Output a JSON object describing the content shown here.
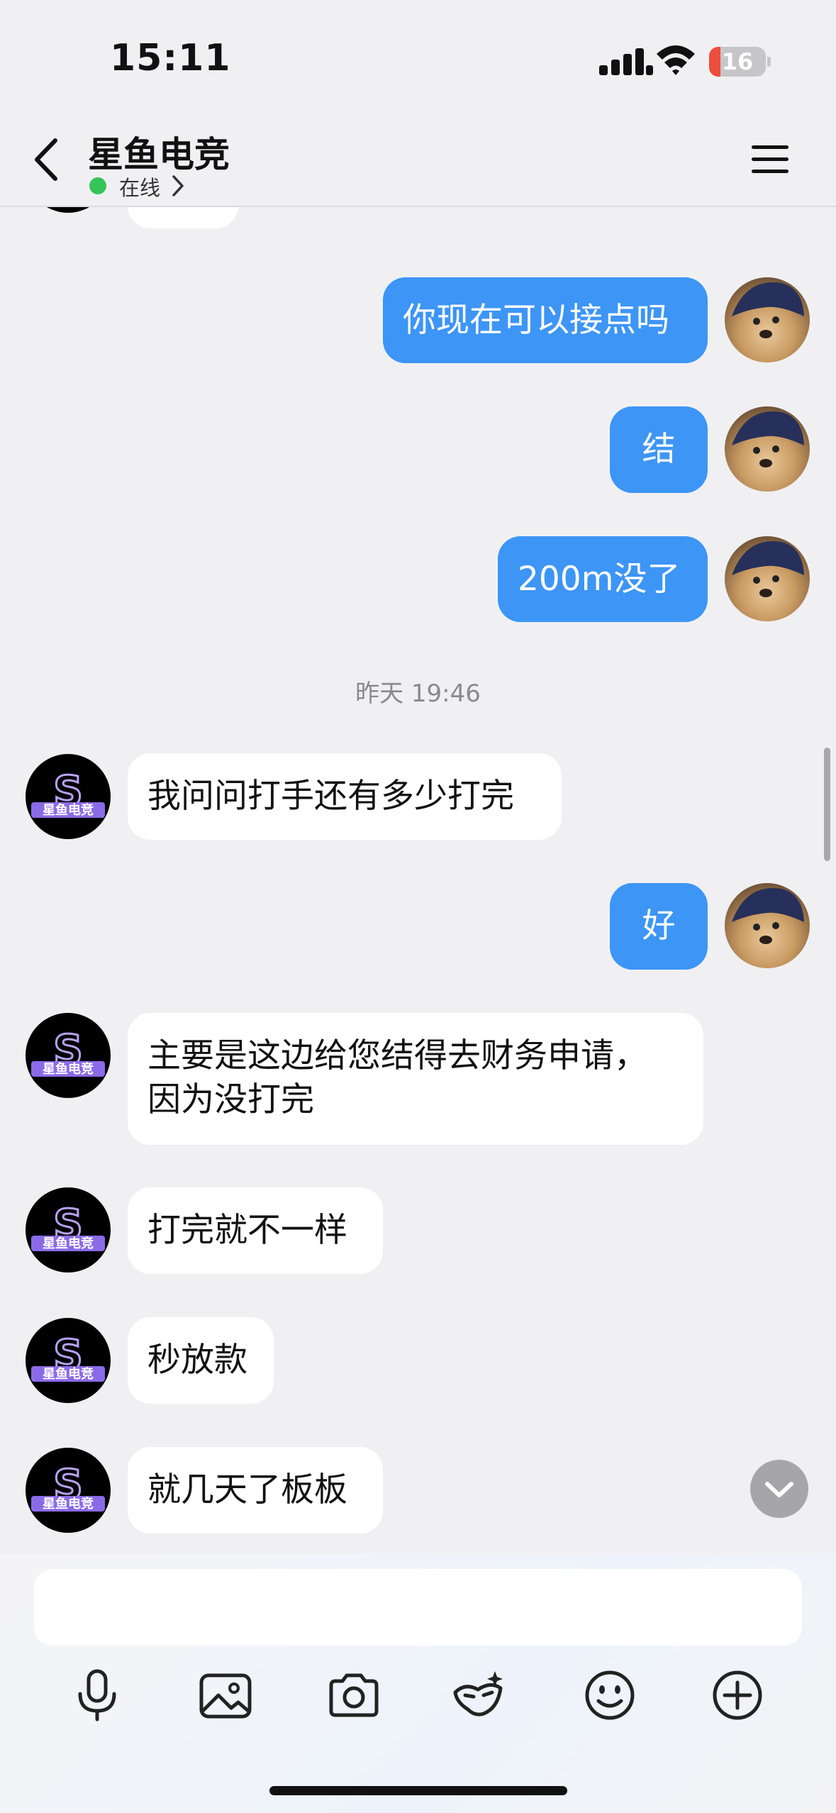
{
  "status_bar": {
    "time": "15:11",
    "battery": "16"
  },
  "header": {
    "title": "星鱼电竞",
    "status": "在线"
  },
  "messages": {
    "m0": "你现在可以接点吗",
    "m1": "结",
    "m2": "200m没了",
    "timestamp": "昨天 19:46",
    "m3": "我问问打手还有多少打完",
    "m4": "好",
    "m5": "主要是这边给您结得去财务申请，\n因为没打完",
    "m6": "打完就不一样",
    "m7": "秒放款",
    "m8": "就几天了板板"
  },
  "avatars": {
    "contact": "星鱼电竞",
    "brand_letter": "S"
  },
  "toolbar": {
    "icons": [
      "microphone-icon",
      "image-icon",
      "camera-icon",
      "mask-icon",
      "emoji-icon",
      "plus-icon"
    ]
  },
  "colors": {
    "outgoing": "#3d95f5",
    "incoming": "#ffffff",
    "online": "#35c45a",
    "background": "#f0f0f2"
  }
}
